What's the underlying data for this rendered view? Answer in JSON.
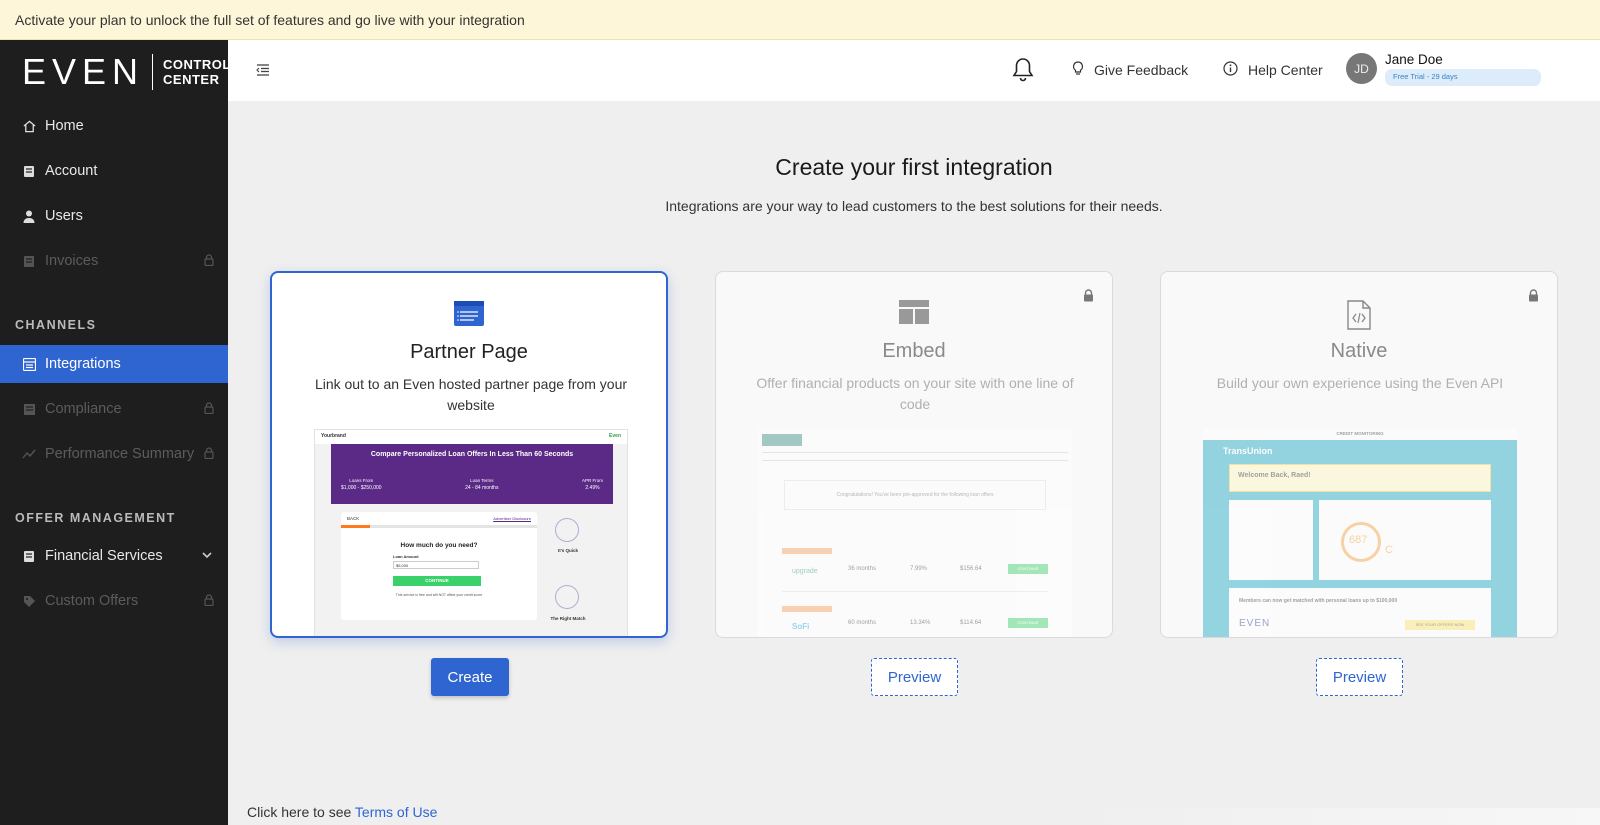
{
  "banner": {
    "text": "Activate your plan to unlock the full set of features and go live with your integration"
  },
  "sidebar": {
    "logo_even": "EVEN",
    "logo_control": "CONTROL",
    "logo_center": "CENTER",
    "items": [
      {
        "label": "Home",
        "icon": "home-icon",
        "disabled": false
      },
      {
        "label": "Account",
        "icon": "account-icon",
        "disabled": false
      },
      {
        "label": "Users",
        "icon": "user-icon",
        "disabled": false
      },
      {
        "label": "Invoices",
        "icon": "invoice-icon",
        "disabled": true,
        "locked": true
      }
    ],
    "channels_label": "CHANNELS",
    "channel_items": [
      {
        "label": "Integrations",
        "icon": "integrations-icon",
        "active": true
      },
      {
        "label": "Compliance",
        "icon": "compliance-icon",
        "disabled": true,
        "locked": true
      },
      {
        "label": "Performance Summary",
        "icon": "chart-line-icon",
        "disabled": true,
        "locked": true
      }
    ],
    "offer_label": "OFFER MANAGEMENT",
    "offer_items": [
      {
        "label": "Financial Services",
        "icon": "financial-icon",
        "expandable": true
      },
      {
        "label": "Custom Offers",
        "icon": "tag-icon",
        "disabled": true,
        "locked": true
      }
    ]
  },
  "topbar": {
    "feedback_label": "Give Feedback",
    "help_label": "Help Center",
    "avatar_initials": "JD",
    "user_name": "Jane Doe",
    "trial_badge": "Free Trial - 29 days"
  },
  "main": {
    "title": "Create your first integration",
    "subtitle": "Integrations are your way to lead customers to the best solutions for their needs.",
    "cards": [
      {
        "title": "Partner Page",
        "description": "Link out to an Even hosted partner page from your website",
        "button": "Create",
        "preview": {
          "brand": "Yourbrand",
          "powered": "Even",
          "headline": "Compare Personalized Loan Offers In Less Than 60 Seconds",
          "back": "BACK",
          "disclosure": "Advertiser Disclosure",
          "question": "How much do you need?",
          "field_label": "Loan Amount",
          "field_value": "$5,000",
          "cta": "CONTINUE",
          "footnote": "This service is free and will NOT affect your credit score",
          "side1": "It's Quick",
          "side2": "The Right Match",
          "stats": [
            {
              "label": "Loans From",
              "value": "$1,000 - $250,000"
            },
            {
              "label": "Loan Terms",
              "value": "24 - 84 months"
            },
            {
              "label": "APR From",
              "value": "2.49%"
            }
          ]
        }
      },
      {
        "title": "Embed",
        "description": "Offer financial products on your site with one line of code",
        "button": "Preview",
        "preview": {
          "congrats": "Congratulations! You've been pre-approved for the following loan offers",
          "rows": [
            {
              "lender": "upgrade",
              "term": "36 months",
              "apr": "7.99%",
              "payment": "$156.64",
              "cta": "CONTINUE"
            },
            {
              "lender": "SoFi",
              "term": "60 months",
              "apr": "13.34%",
              "payment": "$114.64",
              "cta": "CONTINUE"
            }
          ]
        }
      },
      {
        "title": "Native",
        "description": "Build your own experience using the Even API",
        "button": "Preview",
        "preview": {
          "header": "CREDIT MONITORING",
          "brand": "TransUnion",
          "welcome": "Welcome Back, Raed!",
          "score": "687",
          "grade": "C",
          "promo": "Members can now get matched with personal loans up to $100,000",
          "brand2": "EVEN",
          "promo_cta": "SEE YOUR OFFERS NOW"
        }
      }
    ]
  },
  "footer": {
    "text": "Click here to see ",
    "link": "Terms of Use"
  }
}
